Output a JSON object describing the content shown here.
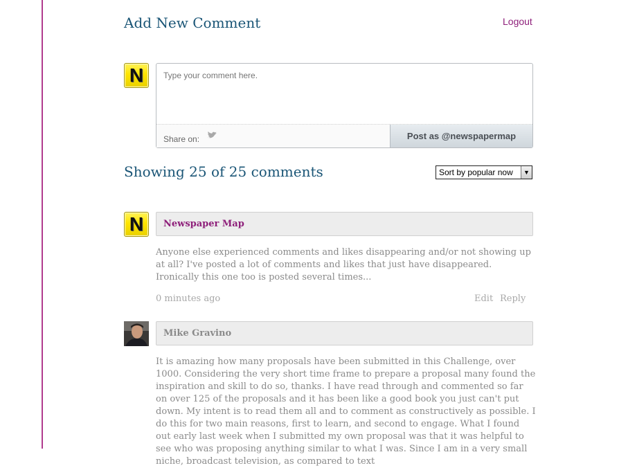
{
  "add_comment": {
    "title": "Add New Comment",
    "logout": "Logout",
    "placeholder": "Type your comment here.",
    "share_on": "Share on:",
    "share_icon": "twitter-bird-icon",
    "post_button": "Post as @newspapermap"
  },
  "comments_header": {
    "title": "Showing 25 of 25 comments",
    "sort_selected": "Sort by popular now"
  },
  "colors": {
    "accent_rule": "#b03a8e",
    "heading": "#1a5576",
    "author_link": "#8e1f7a"
  },
  "comments": [
    {
      "avatar_letter": "N",
      "author": "Newspaper Map",
      "body": "Anyone else experienced comments and likes disappearing and/or not showing up at all? I've posted a lot of comments and likes that just have disappeared. Ironically this one too is posted several times...",
      "time": "0 minutes ago",
      "edit": "Edit",
      "reply": "Reply"
    },
    {
      "author": "Mike Gravino",
      "body": "It is amazing how many proposals have been submitted in this Challenge, over 1000. Considering the very short time frame to prepare a proposal many found the inspiration and skill to do so, thanks. I have read through and commented so far on over 125 of the proposals and it has been like a good book you just can't put down. My intent is to read them all and to comment as constructively as possible. I do this for two main reasons, first to learn, and second to engage. What I found out early last week when I submitted my own proposal was that it was helpful to see who was proposing anything similar to what I was. Since I am in a very small niche, broadcast television, as compared to text"
    }
  ]
}
